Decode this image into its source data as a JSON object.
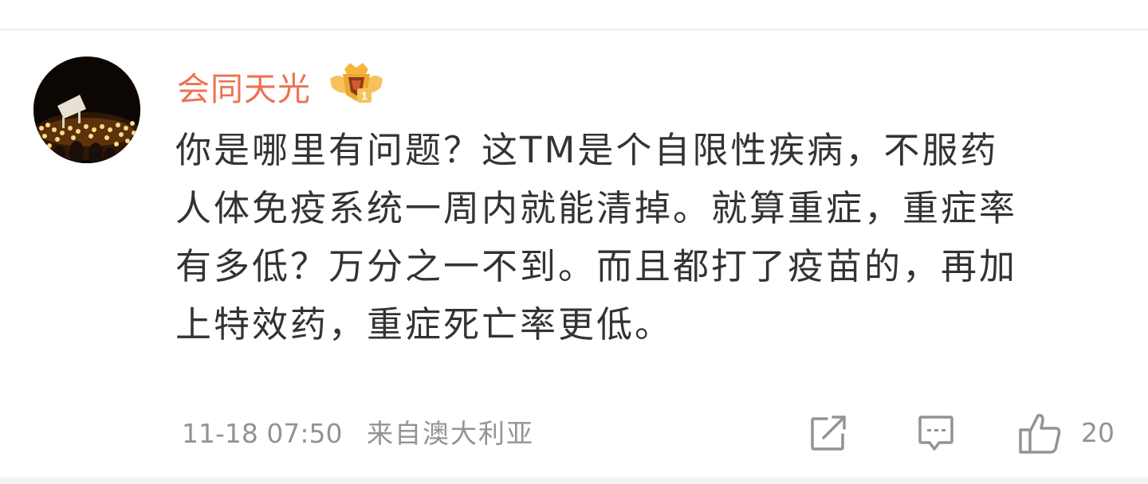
{
  "comment": {
    "username": "会同天光",
    "badge_icon": "crown-level-badge-icon",
    "avatar_icon": "piano-candles-avatar",
    "body_lines": [
      "你是哪里有问题？这TM是个自限性疾病，不服药",
      "人体免疫系统一周内就能清掉。就算重症，重症率",
      "有多低？万分之一不到。而且都打了疫苗的，再加",
      "上特效药，重症死亡率更低。"
    ],
    "timestamp": "11-18 07:50",
    "source": "来自澳大利亚",
    "like_count": "20"
  },
  "actions": {
    "share_icon": "share-icon",
    "comment_icon": "comment-icon",
    "like_icon": "thumbs-up-icon"
  },
  "colors": {
    "username": "#eb7350",
    "body_text": "#333333",
    "meta_text": "#939393",
    "divider": "#ebebeb"
  }
}
